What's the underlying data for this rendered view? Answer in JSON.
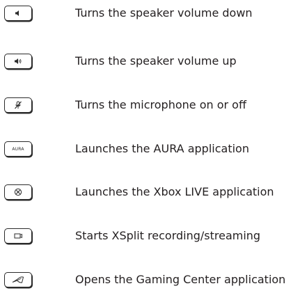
{
  "rows": [
    {
      "icon": "volume-down-icon",
      "description": "Turns the speaker volume down"
    },
    {
      "icon": "volume-up-icon",
      "description": "Turns the speaker volume up"
    },
    {
      "icon": "microphone-mute-icon",
      "description": "Turns the microphone on or off"
    },
    {
      "icon": "aura-key",
      "key_label": "AURA",
      "description": "Launches the AURA application"
    },
    {
      "icon": "xbox-icon",
      "description": "Launches the Xbox LIVE application"
    },
    {
      "icon": "record-icon",
      "description": "Starts XSplit recording/streaming"
    },
    {
      "icon": "rog-logo-icon",
      "description": "Opens the Gaming Center application"
    }
  ]
}
